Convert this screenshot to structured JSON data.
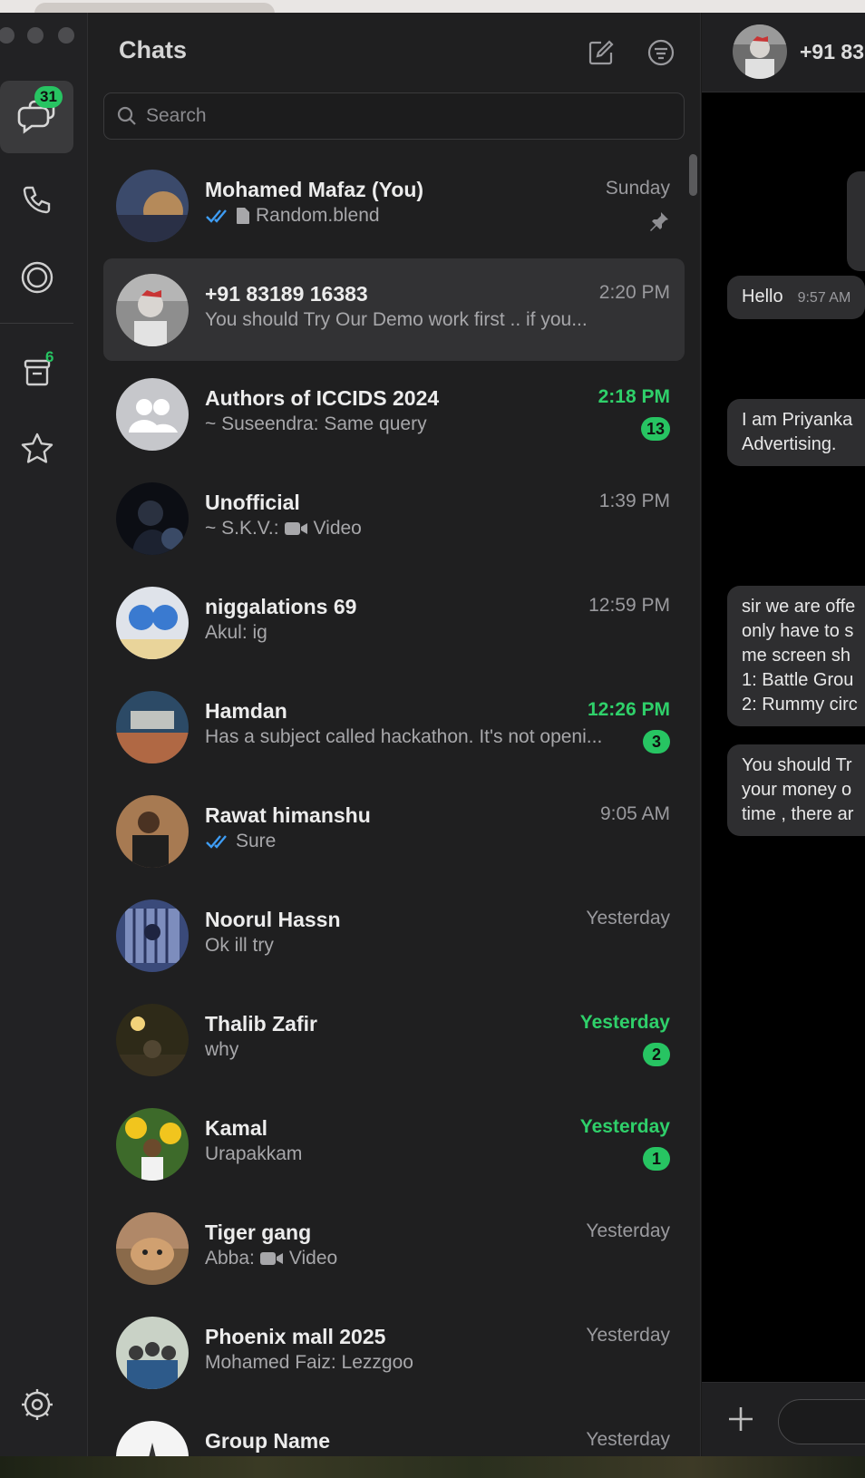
{
  "sidebar": {
    "chats_badge": "31",
    "archived_badge": "6",
    "items": [
      {
        "name": "chats",
        "icon": "chat-bubbles-icon"
      },
      {
        "name": "calls",
        "icon": "phone-icon"
      },
      {
        "name": "status",
        "icon": "status-ring-icon"
      },
      {
        "name": "archived",
        "icon": "archive-icon"
      },
      {
        "name": "starred",
        "icon": "star-icon"
      },
      {
        "name": "settings",
        "icon": "gear-icon"
      }
    ]
  },
  "panel": {
    "title": "Chats",
    "search_placeholder": "Search"
  },
  "colors": {
    "accent_green": "#27c462",
    "read_tick_blue": "#3e9cf3"
  },
  "chats": [
    {
      "name": "Mohamed Mafaz (You)",
      "time": "Sunday",
      "preview": "Random.blend",
      "ticks": true,
      "doc": true,
      "pinned": true
    },
    {
      "name": "+91 83189 16383",
      "time": "2:20 PM",
      "preview": "You should Try Our Demo work first  .. if you...",
      "selected": true
    },
    {
      "name": "Authors of ICCIDS 2024",
      "time": "2:18 PM",
      "preview": "~ Suseendra: Same query",
      "unread": "13"
    },
    {
      "name": "Unofficial",
      "time": "1:39 PM",
      "preview_prefix": "~ S.K.V.:",
      "preview": "Video",
      "video": true
    },
    {
      "name": "niggalations 69",
      "time": "12:59 PM",
      "preview": "Akul: ig"
    },
    {
      "name": "Hamdan",
      "time": "12:26 PM",
      "preview": "Has a subject called hackathon. It's not openi...",
      "unread": "3"
    },
    {
      "name": "Rawat himanshu",
      "time": "9:05 AM",
      "preview": "Sure",
      "ticks": true
    },
    {
      "name": "Noorul Hassn",
      "time": "Yesterday",
      "preview": "Ok ill try"
    },
    {
      "name": "Thalib Zafir",
      "time": "Yesterday",
      "preview": "why",
      "unread": "2"
    },
    {
      "name": "Kamal",
      "time": "Yesterday",
      "preview": "Urapakkam",
      "unread": "1"
    },
    {
      "name": "Tiger gang",
      "time": "Yesterday",
      "preview_prefix": "Abba:",
      "preview": "Video",
      "video": true
    },
    {
      "name": "Phoenix mall 2025",
      "time": "Yesterday",
      "preview": "Mohamed Faiz: Lezzgoo"
    },
    {
      "name": "Group Name",
      "time": "Yesterday",
      "preview": ""
    }
  ],
  "conversation": {
    "contact": "+91 83",
    "messages": [
      {
        "text": "Hello",
        "time": "9:57 AM"
      },
      {
        "text": "I am Priyanka\nAdvertising."
      },
      {
        "text": "sir we are offe\nonly have to s\nme screen sh\n1: Battle Grou\n2: Rummy circ"
      },
      {
        "text": "You should Tr\nyour money o\ntime , there ar"
      }
    ]
  }
}
